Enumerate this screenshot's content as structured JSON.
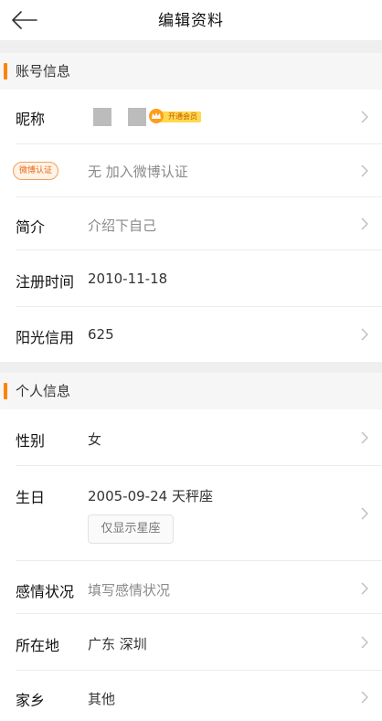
{
  "header": {
    "title": "编辑资料",
    "back_icon": "arrow-left-icon"
  },
  "account_section": {
    "title": "账号信息",
    "nickname": {
      "label": "昵称",
      "vip_label": "开通会员"
    },
    "verification": {
      "badge": "微博认证",
      "value": "无 加入微博认证"
    },
    "bio": {
      "label": "简介",
      "placeholder": "介绍下自己"
    },
    "register": {
      "label": "注册时间",
      "value": "2010-11-18"
    },
    "credit": {
      "label": "阳光信用",
      "value": "625"
    }
  },
  "personal_section": {
    "title": "个人信息",
    "gender": {
      "label": "性别",
      "value": "女"
    },
    "birthday": {
      "label": "生日",
      "value": "2005-09-24 天秤座",
      "option_button": "仅显示星座"
    },
    "relationship": {
      "label": "感情状况",
      "placeholder": "填写感情状况"
    },
    "location": {
      "label": "所在地",
      "value": "广东 深圳"
    },
    "hometown": {
      "label": "家乡",
      "value": "其他"
    }
  },
  "colors": {
    "accent": "#ff8200",
    "vip": "#ffd84d",
    "divider": "#ececec",
    "section_bg": "#f6f6f6"
  }
}
